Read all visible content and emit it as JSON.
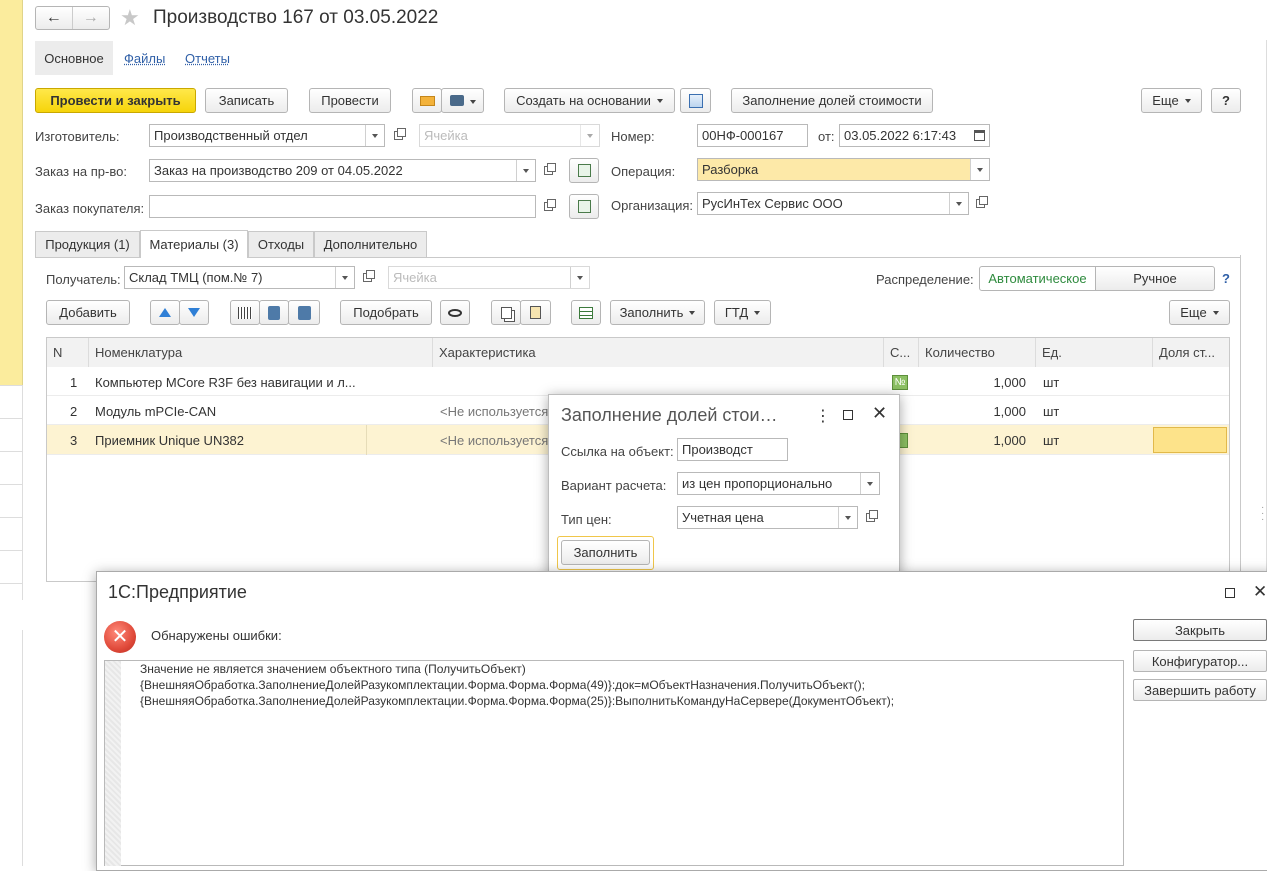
{
  "window": {
    "title": "Производство 167 от 03.05.2022",
    "nav_back": "←",
    "nav_forward": "→"
  },
  "nav_tabs": [
    "Основное",
    "Файлы",
    "Отчеты"
  ],
  "toolbar": {
    "post_close": "Провести и закрыть",
    "save": "Записать",
    "post": "Провести",
    "create_based": "Создать на основании",
    "fill_shares": "Заполнение долей стоимости",
    "more": "Еще",
    "help": "?"
  },
  "form": {
    "maker_label": "Изготовитель:",
    "maker_value": "Производственный отдел",
    "cell_placeholder": "Ячейка",
    "number_label": "Номер:",
    "number_value": "00НФ-000167",
    "from_label": "от:",
    "date_value": "03.05.2022  6:17:43",
    "order_label": "Заказ на пр-во:",
    "order_value": "Заказ на производство 209 от 04.05.2022",
    "operation_label": "Операция:",
    "operation_value": "Разборка",
    "customer_order_label": "Заказ покупателя:",
    "customer_order_value": "",
    "org_label": "Организация:",
    "org_value": "РусИнТех Сервис ООО"
  },
  "doc_tabs": [
    "Продукция (1)",
    "Материалы (3)",
    "Отходы",
    "Дополнительно"
  ],
  "materials": {
    "receiver_label": "Получатель:",
    "receiver_value": "Склад ТМЦ (пом.№ 7)",
    "cell_placeholder": "Ячейка",
    "distribution_label": "Распределение:",
    "dist_auto": "Автоматическое",
    "dist_manual": "Ручное",
    "help": "?",
    "add": "Добавить",
    "pick": "Подобрать",
    "fill": "Заполнить",
    "gtd": "ГТД",
    "more": "Еще"
  },
  "table": {
    "headers": [
      "N",
      "Номенклатура",
      "Характеристика",
      "С...",
      "Количество",
      "Ед.",
      "Доля ст..."
    ],
    "rows": [
      {
        "n": "1",
        "name": "Компьютер MCore R3F без навигации и л...",
        "char": "",
        "qty": "1,000",
        "unit": "шт"
      },
      {
        "n": "2",
        "name": "Модуль mPCIe-CAN",
        "char": "<Не используется",
        "qty": "1,000",
        "unit": "шт"
      },
      {
        "n": "3",
        "name": "Приемник Unique UN382",
        "char": "<Не используется",
        "qty": "1,000",
        "unit": "шт"
      }
    ],
    "badge": "№"
  },
  "fill_dialog": {
    "title": "Заполнение долей стои…",
    "menu": "⋮",
    "ref_label": "Ссылка на объект:",
    "ref_value": "Производст",
    "calc_label": "Вариант расчета:",
    "calc_value": "из цен пропорционально",
    "price_label": "Тип цен:",
    "price_value": "Учетная цена",
    "fill_button": "Заполнить"
  },
  "error_dialog": {
    "title": "1С:Предприятие",
    "message": "Обнаружены ошибки:",
    "close": "Закрыть",
    "configurator": "Конфигуратор...",
    "exit": "Завершить работу",
    "lines": [
      "Значение не является значением объектного типа (ПолучитьОбъект)",
      "{ВнешняяОбработка.ЗаполнениеДолейРазукомплектации.Форма.Форма.Форма(49)}:док=мОбъектНазначения.ПолучитьОбъект();",
      "{ВнешняяОбработка.ЗаполнениеДолейРазукомплектации.Форма.Форма.Форма(25)}:ВыполнитьКомандуНаСервере(ДокументОбъект);"
    ]
  },
  "colors": {
    "accent_yellow": "#f6d40a",
    "row_highlight": "#fdf3d2",
    "field_highlight": "#fde9a8",
    "green_text": "#2e8b3e",
    "link_blue": "#2f5fa7",
    "error_red": "#e04a3a"
  }
}
